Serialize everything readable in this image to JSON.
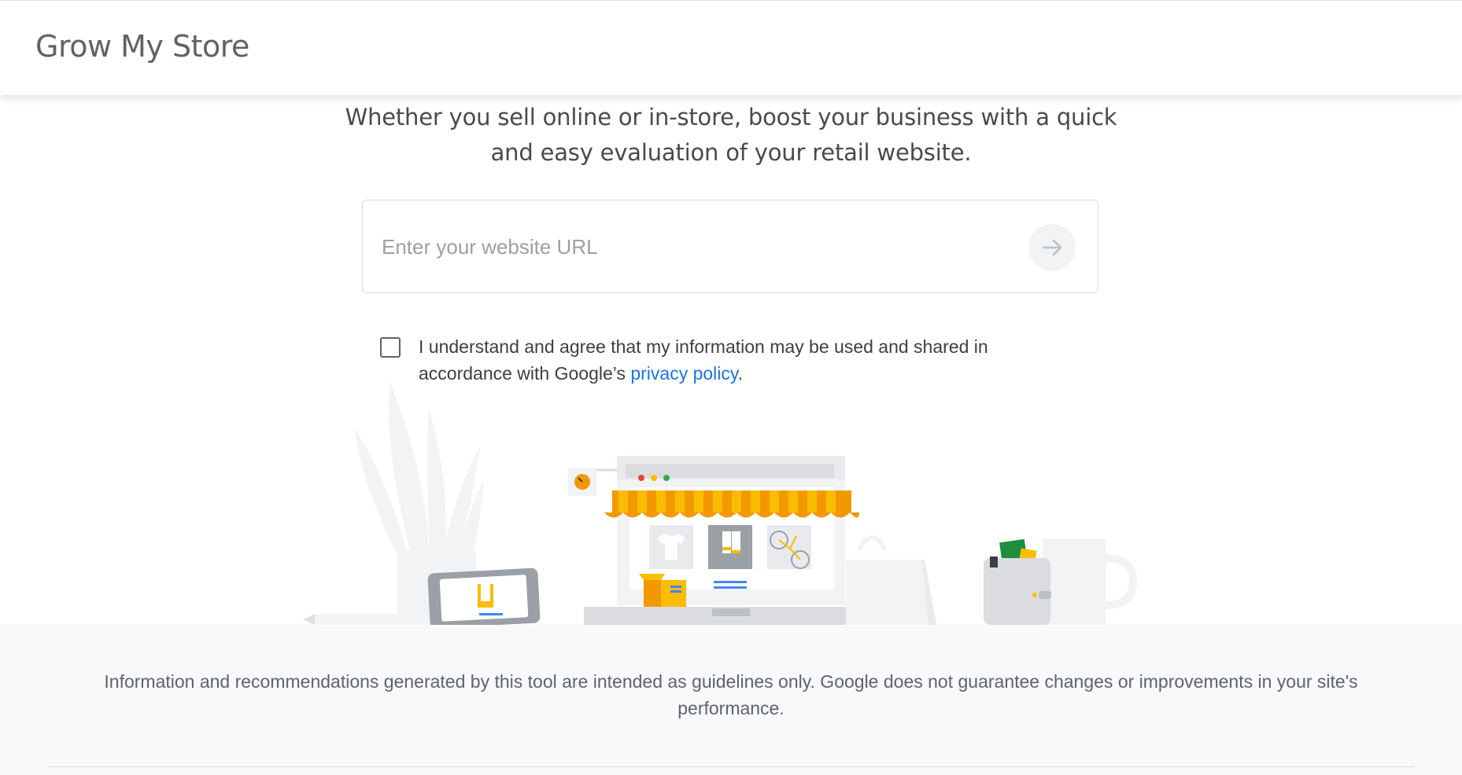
{
  "header": {
    "title": "Grow My Store"
  },
  "hero": {
    "tagline_line1": "Whether you sell online or in-store, boost your business with a quick",
    "tagline_line2": "and easy evaluation of your retail website."
  },
  "search": {
    "placeholder": "Enter your website URL",
    "value": "",
    "submit_icon": "arrow-right-icon"
  },
  "consent": {
    "checked": false,
    "text_before": "I understand and agree that my information may be used and shared in accordance with Google’s ",
    "link_text": "privacy policy",
    "text_after": "."
  },
  "illustration": {
    "icons": [
      "plant-icon",
      "tablet-icon",
      "pencil-icon",
      "clock-icon",
      "storefront-laptop-icon",
      "shirt-icon",
      "socks-icon",
      "bicycle-icon",
      "box-icon",
      "shopping-bag-icon",
      "wallet-icon",
      "mug-icon"
    ],
    "colors": {
      "awning_orange": "#f29900",
      "awning_yellow": "#fbbc04",
      "dot_red": "#ea4335",
      "dot_yellow": "#fbbc04",
      "dot_green": "#34a853",
      "blue_line": "#4285f4",
      "card_green": "#1e8e3e"
    }
  },
  "footer": {
    "disclaimer": "Information and recommendations generated by this tool are intended as guidelines only. Google does not guarantee changes or improvements in your site's performance."
  }
}
